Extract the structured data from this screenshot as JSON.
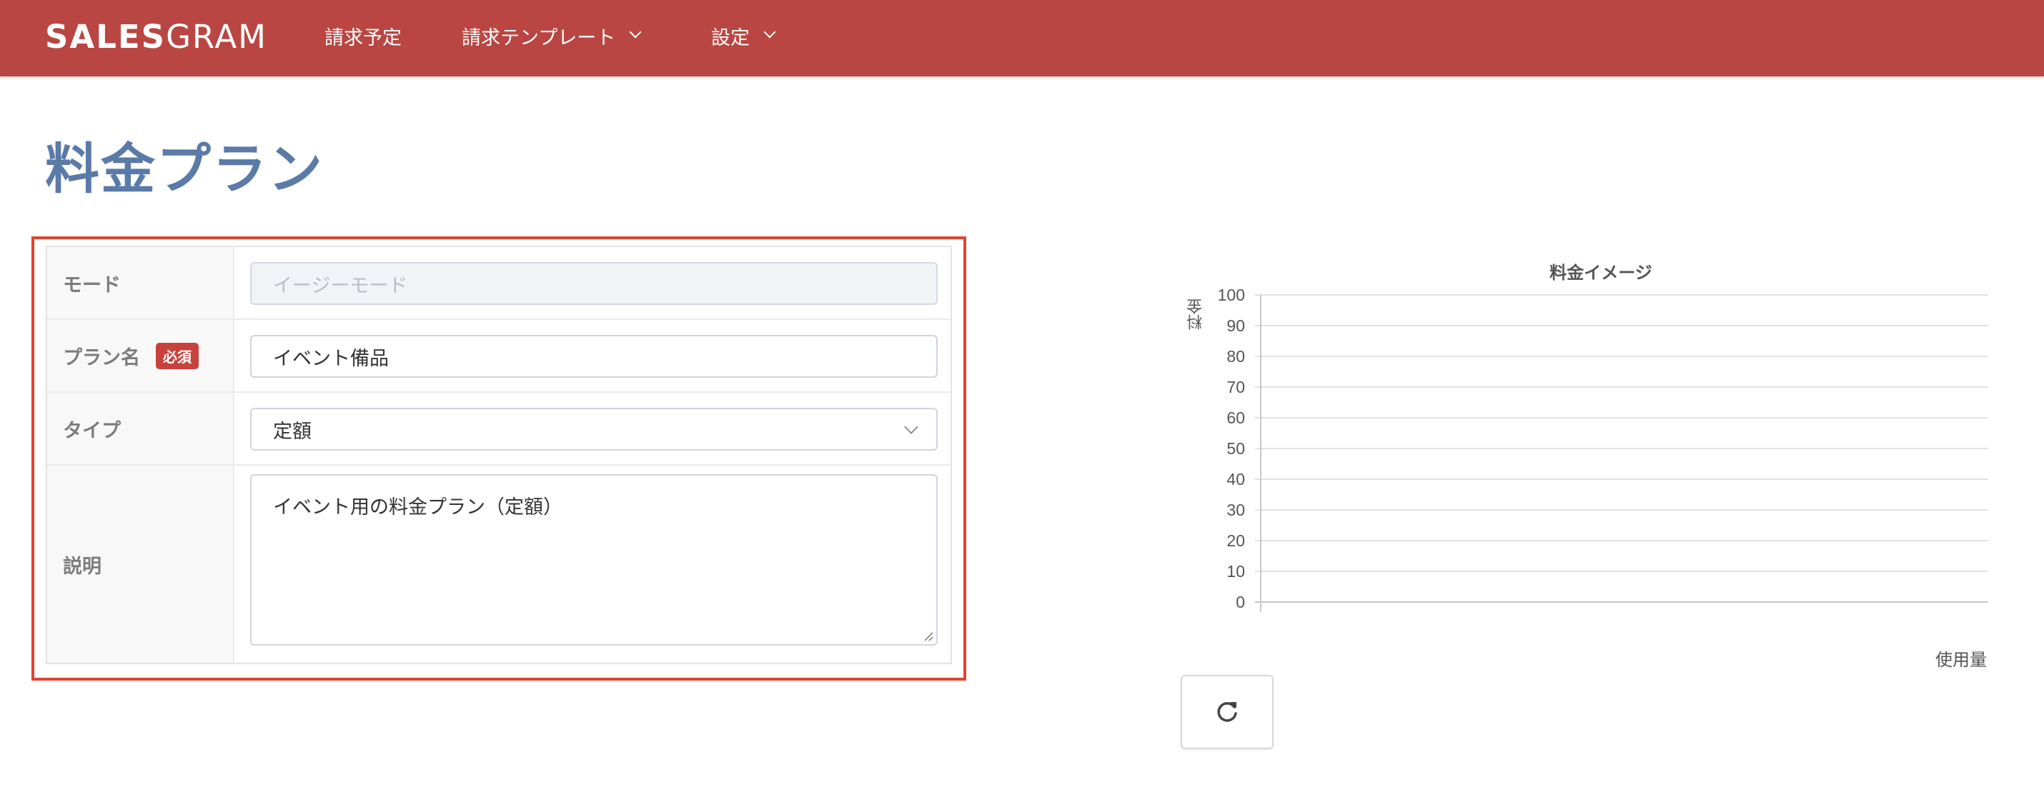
{
  "header": {
    "brand_bold": "SALES",
    "brand_light": "GRAM",
    "nav": [
      {
        "label": "請求予定",
        "has_dropdown": false
      },
      {
        "label": "請求テンプレート",
        "has_dropdown": true
      },
      {
        "label": "設定",
        "has_dropdown": true
      }
    ],
    "bg_color": "#b94642"
  },
  "page": {
    "title": "料金プラン",
    "title_color": "#5a7aa8"
  },
  "form": {
    "highlight_color": "#e0432f",
    "rows": [
      {
        "label": "モード",
        "placeholder": "イージーモード",
        "disabled": true
      },
      {
        "label": "プラン名",
        "required_badge": "必須",
        "value": "イベント備品"
      },
      {
        "label": "タイプ",
        "value": "定額",
        "type": "select"
      },
      {
        "label": "説明",
        "value": "イベント用の料金プラン（定額）",
        "type": "textarea"
      }
    ]
  },
  "chart": {
    "refresh_icon": "refresh-icon"
  },
  "chart_data": {
    "type": "line",
    "title": "料金イメージ",
    "xlabel": "使用量",
    "ylabel": "料金",
    "ylim": [
      0,
      100
    ],
    "yticks": [
      0,
      10,
      20,
      30,
      40,
      50,
      60,
      70,
      80,
      90,
      100
    ],
    "series": [],
    "grid": true
  }
}
